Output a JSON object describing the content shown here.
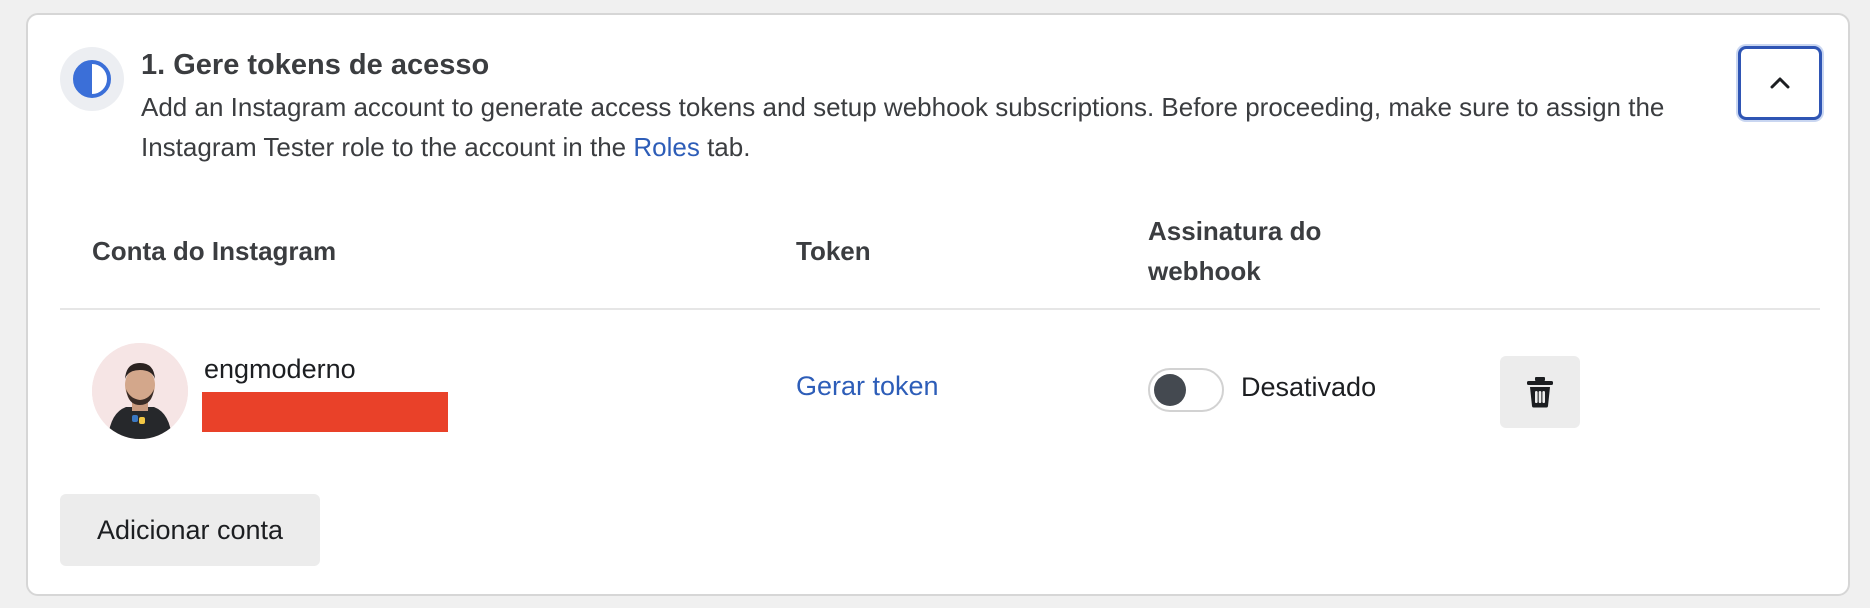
{
  "step": {
    "title": "1. Gere tokens de acesso",
    "description_before": "Add an Instagram account to generate access tokens and setup webhook subscriptions. Before proceeding, make sure to assign the Instagram Tester role to the account in the ",
    "roles_link": "Roles",
    "description_after": " tab.",
    "status_icon": "half-circle-progress-icon",
    "collapse_icon": "chevron-up-icon"
  },
  "table": {
    "headers": {
      "account": "Conta do Instagram",
      "token": "Token",
      "webhook": "Assinatura do webhook"
    },
    "rows": [
      {
        "username": "engmoderno",
        "token_action": "Gerar token",
        "webhook_state": "Desativado",
        "webhook_enabled": false,
        "delete_icon": "trash-icon"
      }
    ]
  },
  "actions": {
    "add_account": "Adicionar conta"
  },
  "colors": {
    "link": "#2d5db8",
    "accent_border": "#2f55b4",
    "redaction": "#e94129"
  }
}
